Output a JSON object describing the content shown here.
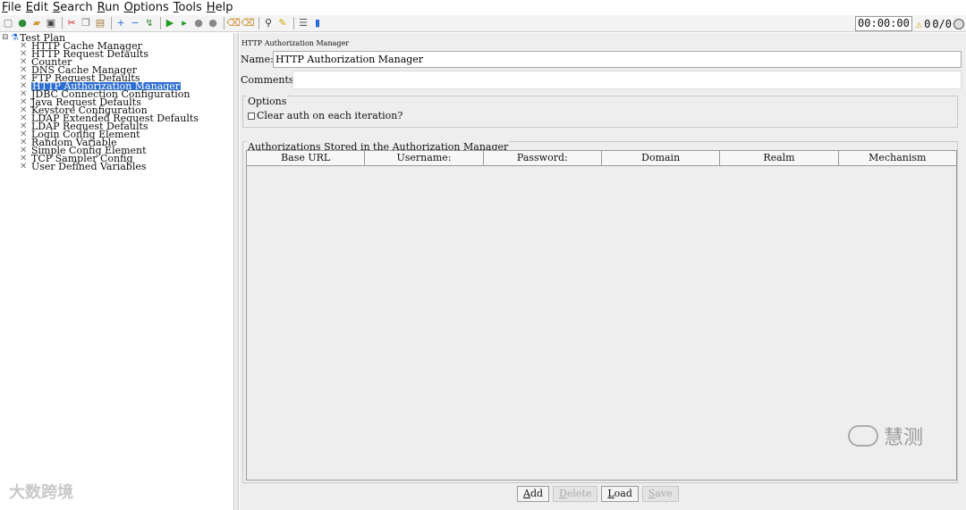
{
  "menubar": [
    {
      "pre": "",
      "u": "F",
      "post": "ile"
    },
    {
      "pre": "",
      "u": "E",
      "post": "dit"
    },
    {
      "pre": "",
      "u": "S",
      "post": "earch"
    },
    {
      "pre": "",
      "u": "R",
      "post": "un"
    },
    {
      "pre": "",
      "u": "O",
      "post": "ptions"
    },
    {
      "pre": "",
      "u": "T",
      "post": "ools"
    },
    {
      "pre": "",
      "u": "H",
      "post": "elp"
    }
  ],
  "status": {
    "timer": "00:00:00",
    "warning_count": "0",
    "thread_counts": "0/0"
  },
  "tree": {
    "root": "Test Plan",
    "items": [
      "HTTP Cache Manager",
      "HTTP Request Defaults",
      "Counter",
      "DNS Cache Manager",
      "FTP Request Defaults",
      "HTTP Authorization Manager",
      "JDBC Connection Configuration",
      "Java Request Defaults",
      "Keystore Configuration",
      "LDAP Extended Request Defaults",
      "LDAP Request Defaults",
      "Login Config Element",
      "Random Variable",
      "Simple Config Element",
      "TCP Sampler Config",
      "User Defined Variables"
    ],
    "selected_index": 5
  },
  "panel": {
    "title": "HTTP Authorization Manager",
    "name_label": "Name:",
    "name_value": "HTTP Authorization Manager",
    "comments_label": "Comments:",
    "options_legend": "Options",
    "clear_auth_label": "Clear auth on each iteration?",
    "auth_legend": "Authorizations Stored in the Authorization Manager",
    "columns": [
      "Base URL",
      "Username:",
      "Password:",
      "Domain",
      "Realm",
      "Mechanism"
    ],
    "buttons": [
      {
        "pre": "",
        "u": "A",
        "post": "dd",
        "enabled": true
      },
      {
        "pre": "",
        "u": "D",
        "post": "elete",
        "enabled": false
      },
      {
        "pre": "",
        "u": "L",
        "post": "oad",
        "enabled": true
      },
      {
        "pre": "",
        "u": "S",
        "post": "ave",
        "enabled": false
      }
    ]
  },
  "watermarks": {
    "left": "大数跨境",
    "right": "慧测"
  }
}
